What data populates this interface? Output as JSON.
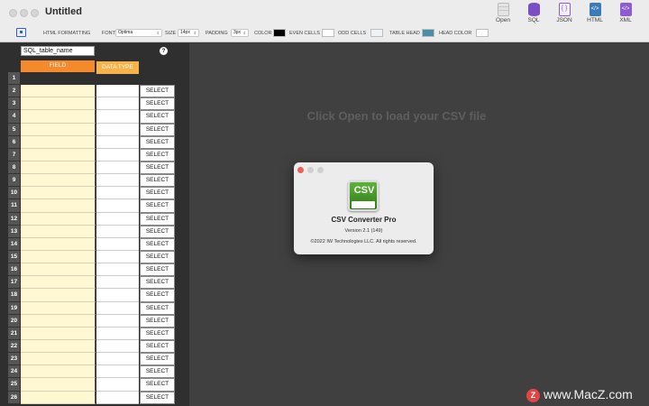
{
  "window": {
    "title": "Untitled"
  },
  "toolbar": [
    {
      "id": "open",
      "label": "Open",
      "icon": "spreadsheet-icon",
      "color": "#c9c9c9"
    },
    {
      "id": "sql",
      "label": "SQL",
      "icon": "database-icon",
      "color": "#7b4fc4"
    },
    {
      "id": "json",
      "label": "JSON",
      "icon": "braces-icon",
      "color": "#8e5bd0"
    },
    {
      "id": "html",
      "label": "HTML",
      "icon": "code-icon",
      "color": "#3d7bb8"
    },
    {
      "id": "xml",
      "label": "XML",
      "icon": "code-icon",
      "color": "#8e5bd0"
    }
  ],
  "formatting": {
    "toggle_icon": "html-format-toggle-icon",
    "html_formatting_label": "HTML FORMATTING",
    "font_label": "FONT",
    "font_value": "Optima",
    "size_label": "SIZE",
    "size_value": "14px",
    "padding_label": "PADDING",
    "padding_value": "3px",
    "color_label": "COLOR",
    "color_value": "#000000",
    "even_cells_label": "EVEN CELLS",
    "even_cells_color": "#ffffff",
    "odd_cells_label": "ODD CELLS",
    "odd_cells_color": "#eef3f8",
    "table_head_label": "TABLE HEAD",
    "table_head_color": "#4a8ea8",
    "head_color_label": "HEAD COLOR",
    "head_color_value": "#ffffff"
  },
  "table": {
    "name_value": "SQL_table_name",
    "help_label": "?",
    "field_header": "FIELD",
    "type_header": "DATA TYPE",
    "select_label": "SELECT",
    "rows": [
      "1",
      "2",
      "3",
      "4",
      "5",
      "6",
      "7",
      "8",
      "9",
      "10",
      "11",
      "12",
      "13",
      "14",
      "15",
      "16",
      "17",
      "18",
      "19",
      "20",
      "21",
      "22",
      "23",
      "24",
      "25",
      "26"
    ]
  },
  "main": {
    "placeholder": "Click Open to load your CSV file"
  },
  "about": {
    "app_name": "CSV Converter Pro",
    "version": "Version 2.1 (149)",
    "copyright": "©2022 IW Technologies LLC. All rights reserved.",
    "icon_text": "CSV"
  },
  "watermark": {
    "logo": "Z",
    "text": "www.MacZ.com"
  }
}
